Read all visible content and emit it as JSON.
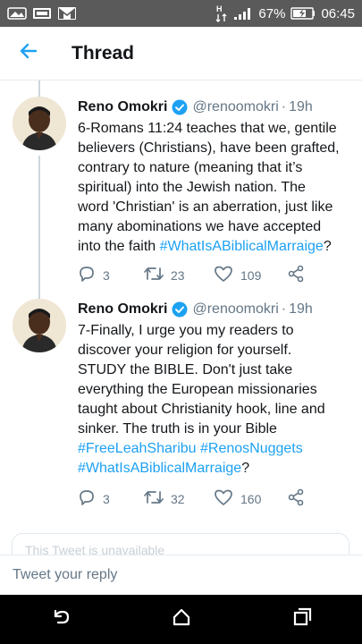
{
  "status_bar": {
    "battery_percent": "67%",
    "clock": "06:45",
    "icons": [
      "gallery-icon",
      "image-icon",
      "m-logo-icon",
      "data-transfer-icon",
      "signal-icon",
      "battery-icon"
    ]
  },
  "header": {
    "title": "Thread",
    "back_icon": "arrow-left-icon"
  },
  "tweets": [
    {
      "author": "Reno Omokri",
      "handle": "@renoomokri",
      "separator": "·",
      "time": "19h",
      "text_lines": [
        "6-Romans 11:24 teaches that we, gentile",
        "believers (Christians), have been grafted,",
        "contrary to nature (meaning that it’s",
        "spiritual) into the Jewish nation. The",
        "word 'Christian' is an aberration, just like",
        "many abominations we have accepted"
      ],
      "last_line_prefix": "into the faith ",
      "last_line_hashtag": "#WhatIsABiblicalMarraige",
      "last_line_suffix": "?",
      "replies": "3",
      "retweets": "23",
      "likes": "109"
    },
    {
      "author": "Reno Omokri",
      "handle": "@renoomokri",
      "separator": "·",
      "time": "19h",
      "text_lines": [
        "7-Finally, I urge you my readers to",
        "discover your religion for yourself.",
        "STUDY the BIBLE. Don't just take",
        "everything the European missionaries",
        "taught about Christianity hook, line and",
        "sinker. The truth is in your Bible"
      ],
      "hashtag_line_1a": "#FreeLeahSharibu",
      "hashtag_line_1b": "#RenosNuggets",
      "hashtag_line_2": "#WhatIsABiblicalMarraige",
      "hashtag_line_2_suffix": "?",
      "replies": "3",
      "retweets": "32",
      "likes": "160"
    }
  ],
  "quoted_card": {
    "partial_text": "This Tweet is unavailable"
  },
  "reply": {
    "placeholder": "Tweet your reply"
  },
  "nav": {
    "icons": [
      "back-nav-icon",
      "home-nav-icon",
      "recents-nav-icon"
    ]
  },
  "colors": {
    "accent": "#1da1f2",
    "status_bar": "#5a5a5a",
    "nav_bar": "#000000",
    "muted_text": "#657786"
  }
}
